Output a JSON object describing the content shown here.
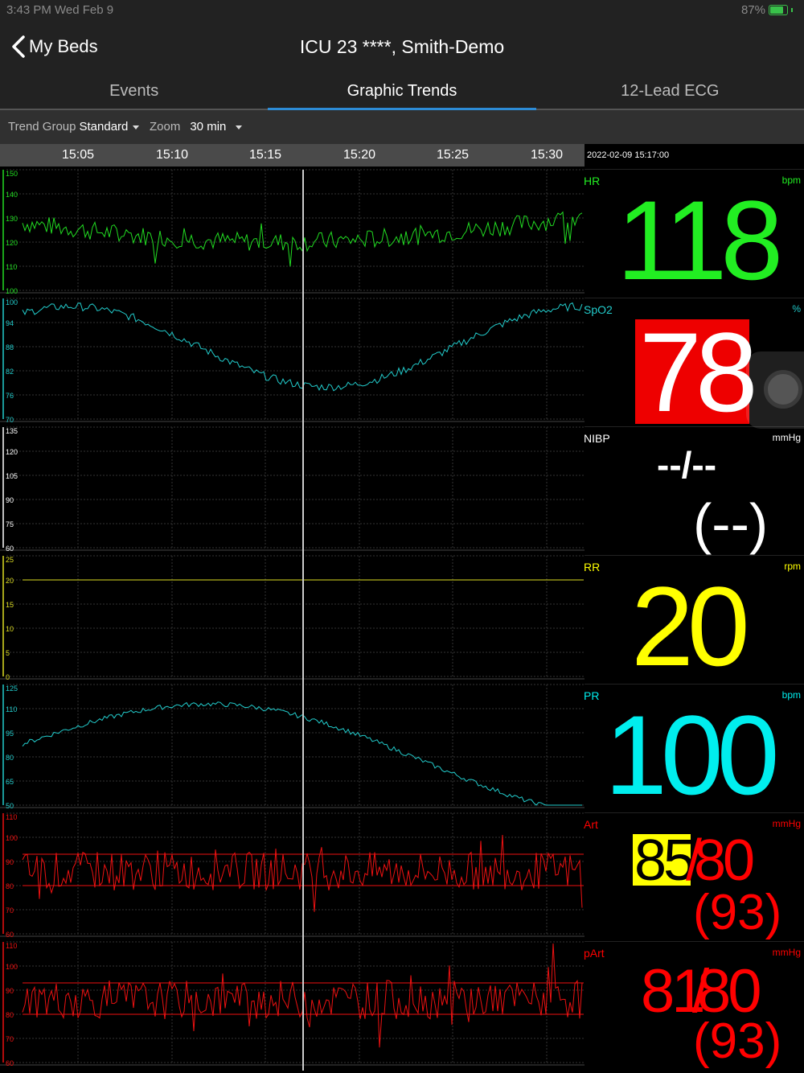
{
  "status_bar": {
    "time": "3:43 PM   Wed Feb 9",
    "battery": "87%"
  },
  "nav": {
    "back_label": "My Beds",
    "title": "ICU 23 ****, Smith-Demo"
  },
  "tabs": [
    {
      "label": "Events",
      "active": false
    },
    {
      "label": "Graphic Trends",
      "active": true
    },
    {
      "label": "12-Lead ECG",
      "active": false
    }
  ],
  "toolbar": {
    "trend_group_label": "Trend Group",
    "trend_group_value": "Standard",
    "zoom_label": "Zoom",
    "zoom_value": "30 min"
  },
  "time_axis": {
    "ticks": [
      "15:05",
      "15:10",
      "15:15",
      "15:20",
      "15:25",
      "15:30"
    ]
  },
  "cursor_timestamp": "2022-02-09 15:17:00",
  "trends": [
    {
      "name": "HR",
      "color": "#22dd22",
      "scale": [
        "150",
        "140",
        "130",
        "120",
        "110",
        "100"
      ],
      "min": 100,
      "max": 150
    },
    {
      "name": "SpO2",
      "color": "#22cccc",
      "scale": [
        "100",
        "94",
        "88",
        "82",
        "76",
        "70"
      ],
      "min": 70,
      "max": 100
    },
    {
      "name": "NIBP",
      "color": "#ffffff",
      "scale": [
        "135",
        "120",
        "105",
        "90",
        "75",
        "60"
      ],
      "min": 60,
      "max": 135
    },
    {
      "name": "RR",
      "color": "#dddd22",
      "scale": [
        "25",
        "20",
        "15",
        "10",
        "5",
        "0"
      ],
      "min": 0,
      "max": 25
    },
    {
      "name": "PR",
      "color": "#22cccc",
      "scale": [
        "125",
        "110",
        "95",
        "80",
        "65",
        "50"
      ],
      "min": 50,
      "max": 125
    },
    {
      "name": "Art",
      "color": "#ee1111",
      "scale": [
        "110",
        "100",
        "90",
        "80",
        "70",
        "60"
      ],
      "min": 60,
      "max": 110
    },
    {
      "name": "pArt",
      "color": "#ee1111",
      "scale": [
        "110",
        "100",
        "90",
        "80",
        "70",
        "60"
      ],
      "min": 60,
      "max": 110
    }
  ],
  "vitals": {
    "hr": {
      "label": "HR",
      "unit": "bpm",
      "value": "118",
      "color": "#22ee22"
    },
    "spo2": {
      "label": "SpO2",
      "unit": "%",
      "value": "78",
      "alarm_color": "#ee0000",
      "color": "#22cccc"
    },
    "nibp": {
      "label": "NIBP",
      "unit": "mmHg",
      "value": "--/--",
      "mean": "(--)"
    },
    "rr": {
      "label": "RR",
      "unit": "rpm",
      "value": "20",
      "color": "#ffff00"
    },
    "pr": {
      "label": "PR",
      "unit": "bpm",
      "value": "100",
      "color": "#00eeee"
    },
    "art": {
      "label": "Art",
      "unit": "mmHg",
      "systolic": "85",
      "diastolic": "80",
      "separator": "/",
      "mean": "(93)",
      "color": "#ff0000",
      "alarm_color": "#ffff00"
    },
    "part": {
      "label": "pArt",
      "unit": "mmHg",
      "systolic": "81",
      "diastolic": "80",
      "separator": "/",
      "mean": "(93)",
      "color": "#ff0000"
    }
  }
}
